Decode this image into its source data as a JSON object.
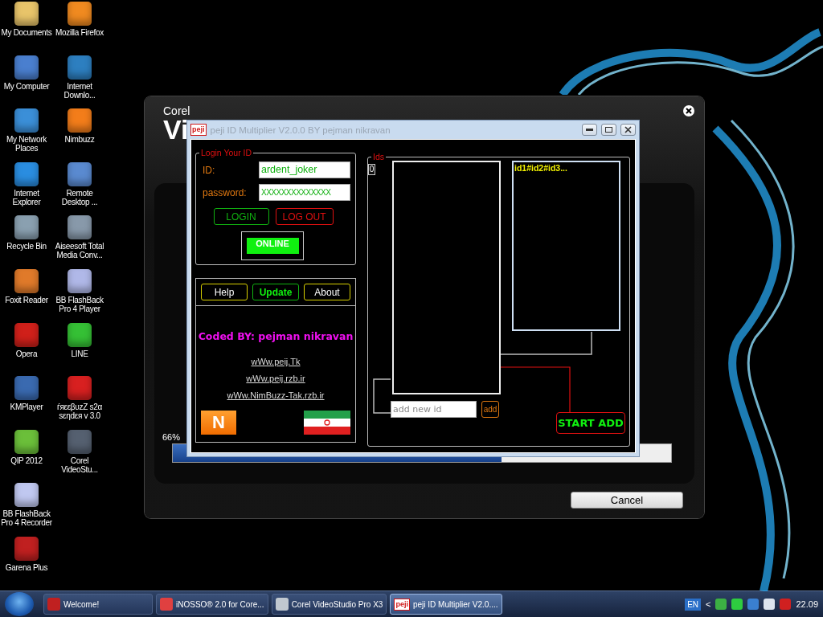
{
  "desktop_icons": [
    {
      "label": "My Documents"
    },
    {
      "label": "My Computer"
    },
    {
      "label": "My Network Places"
    },
    {
      "label": "Internet Explorer"
    },
    {
      "label": "Recycle Bin"
    },
    {
      "label": "Foxit Reader"
    },
    {
      "label": "Opera"
    },
    {
      "label": "KMPlayer"
    },
    {
      "label": "QIP 2012"
    },
    {
      "label": "BB FlashBack Pro 4 Recorder"
    },
    {
      "label": "Garena Plus"
    },
    {
      "label": "Mozilla Firefox"
    },
    {
      "label": "Internet Downlo..."
    },
    {
      "label": "Nimbuzz"
    },
    {
      "label": "Remote Desktop ..."
    },
    {
      "label": "Aiseesoft Total Media Conv..."
    },
    {
      "label": "BB FlashBack Pro 4 Player"
    },
    {
      "label": "LINE"
    },
    {
      "label": "ѓяεεβυzZ s2α sεηdεя v 3.0"
    },
    {
      "label": "Corel VideoStu..."
    }
  ],
  "corel_window": {
    "brand": "Corel",
    "title": "Vi",
    "percent": "66%",
    "progress": {
      "level": 0.66
    },
    "cancel": "Cancel"
  },
  "peji_window": {
    "icon_text": "peji",
    "title": "peji ID Multiplier V2.0.0 BY pejman nikravan",
    "login": {
      "legend": "Login Your ID",
      "id_label": "ID:",
      "id_value": "ardent_joker",
      "password_label": "password:",
      "password_value": "XXXXXXXXXXXXXX",
      "login_button": "LOGIN",
      "logout_button": "LOG OUT",
      "status": {
        "label": "ONLINE",
        "online": true
      }
    },
    "menu_buttons": [
      {
        "label": "Help",
        "kind": "plain"
      },
      {
        "label": "Update",
        "kind": "accent"
      },
      {
        "label": "About",
        "kind": "plain"
      }
    ],
    "credit": "Coded BY: pejman nikravan",
    "links": [
      "wWw.peij.Tk",
      "wWw.peij.rzb.ir",
      "wWw.NimBuzz-Tak.rzb.ir"
    ],
    "logo_letter": "N",
    "ids": {
      "legend": "Ids",
      "count": "0",
      "bulk_text": "id1#id2#id3...",
      "new_id_placeholder": "add new id",
      "add_button": "add",
      "start_button": "START ADD"
    }
  },
  "taskbar": {
    "items": [
      {
        "label": "Welcome!",
        "selected": false
      },
      {
        "label": "iNOSSO® 2.0 for Core...",
        "selected": false
      },
      {
        "label": "Corel VideoStudio Pro X3",
        "selected": false
      },
      {
        "label": "peji ID Multiplier V2.0....",
        "selected": true,
        "icon_text": "peji"
      }
    ],
    "language": "EN",
    "tray_toggle": "<",
    "clock": "22.09"
  }
}
